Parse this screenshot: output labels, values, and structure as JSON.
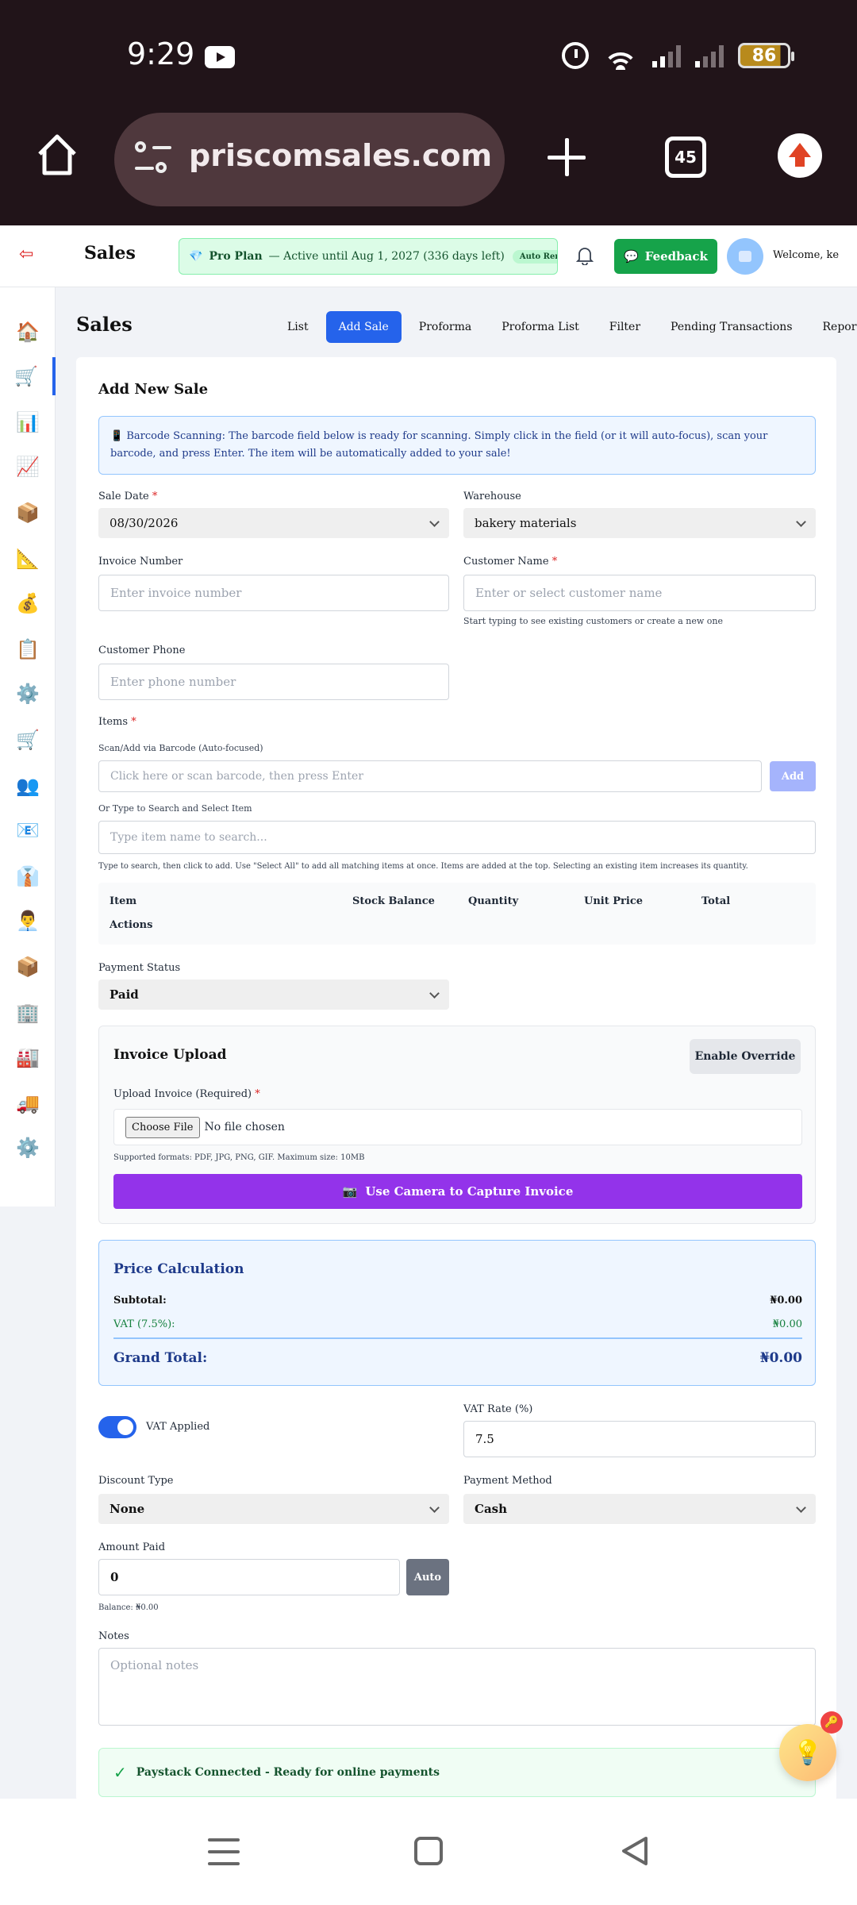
{
  "status_bar": {
    "time": "9:29",
    "battery": "86"
  },
  "browser": {
    "url": "priscomsales.com/das",
    "tab_count": "45"
  },
  "header": {
    "title": "Sales",
    "plan_name": "Pro Plan",
    "plan_status": "— Active until Aug 1, 2027 (336 days left)",
    "plan_badge": "Auto Renew On",
    "feedback_label": "Feedback",
    "welcome": "Welcome, ke"
  },
  "sidebar": {
    "items": [
      {
        "icon": "🏠",
        "name": "home"
      },
      {
        "icon": "🛒",
        "name": "sales"
      },
      {
        "icon": "📊",
        "name": "reports"
      },
      {
        "icon": "📈",
        "name": "analytics"
      },
      {
        "icon": "📦",
        "name": "inventory"
      },
      {
        "icon": "📐",
        "name": "measurements"
      },
      {
        "icon": "💰",
        "name": "finance"
      },
      {
        "icon": "📋",
        "name": "records"
      },
      {
        "icon": "⚙️",
        "name": "settings"
      },
      {
        "icon": "🛒",
        "name": "purchases"
      },
      {
        "icon": "👥",
        "name": "customers"
      },
      {
        "icon": "📧",
        "name": "email"
      },
      {
        "icon": "👔",
        "name": "staff"
      },
      {
        "icon": "👨‍💼",
        "name": "managers"
      },
      {
        "icon": "📦",
        "name": "stock"
      },
      {
        "icon": "🏢",
        "name": "company"
      },
      {
        "icon": "🏭",
        "name": "warehouses"
      },
      {
        "icon": "🚚",
        "name": "delivery"
      },
      {
        "icon": "⚙️",
        "name": "configuration"
      }
    ]
  },
  "page": {
    "title": "Sales",
    "tabs": [
      "List",
      "Add Sale",
      "Proforma",
      "Proforma List",
      "Filter",
      "Pending Transactions",
      "Report"
    ]
  },
  "form": {
    "title": "Add New Sale",
    "notice_icon": "📱",
    "notice": "Barcode Scanning: The barcode field below is ready for scanning. Simply click in the field (or it will auto-focus), scan your barcode, and press Enter. The item will be automatically added to your sale!",
    "sale_date_label": "Sale Date",
    "sale_date": "08/30/2026",
    "warehouse_label": "Warehouse",
    "warehouse": "bakery materials",
    "invoice_label": "Invoice Number",
    "invoice_placeholder": "Enter invoice number",
    "customer_label": "Customer Name",
    "customer_placeholder": "Enter or select customer name",
    "customer_help": "Start typing to see existing customers or create a new one",
    "phone_label": "Customer Phone",
    "phone_placeholder": "Enter phone number",
    "items_label": "Items",
    "scan_label": "Scan/Add via Barcode (Auto-focused)",
    "scan_placeholder": "Click here or scan barcode, then press Enter",
    "add_label": "Add",
    "search_label": "Or Type to Search and Select Item",
    "search_placeholder": "Type item name to search...",
    "search_help": "Type to search, then click to add. Use \"Select All\" to add all matching items at once. Items are added at the top. Selecting an existing item increases its quantity.",
    "table_headers": [
      "Item",
      "Stock Balance",
      "Quantity",
      "Unit Price",
      "Total",
      "Actions"
    ],
    "payment_status_label": "Payment Status",
    "payment_status": "Paid",
    "upload_title": "Invoice Upload",
    "override_label": "Enable Override",
    "upload_label": "Upload Invoice (Required)",
    "choose_file": "Choose File",
    "no_file": "No file chosen",
    "formats": "Supported formats: PDF, JPG, PNG, GIF. Maximum size: 10MB",
    "camera_icon": "📷",
    "camera_label": "Use Camera to Capture Invoice",
    "price_title": "Price Calculation",
    "subtotal_label": "Subtotal:",
    "subtotal": "₦0.00",
    "vat_label": "VAT (7.5%):",
    "vat": "₦0.00",
    "grand_total_label": "Grand Total:",
    "grand_total": "₦0.00",
    "vat_applied_label": "VAT Applied",
    "vat_rate_label": "VAT Rate (%)",
    "vat_rate": "7.5",
    "discount_label": "Discount Type",
    "discount": "None",
    "method_label": "Payment Method",
    "method": "Cash",
    "amount_label": "Amount Paid",
    "amount": "0",
    "auto_label": "Auto",
    "balance": "Balance: ₦0.00",
    "notes_label": "Notes",
    "notes_placeholder": "Optional notes",
    "paystack": "Paystack Connected - Ready for online payments"
  },
  "colors": {
    "primary": "#2563eb",
    "success": "#16a34a",
    "camera": "#9333ea",
    "chrome": "#211419"
  }
}
